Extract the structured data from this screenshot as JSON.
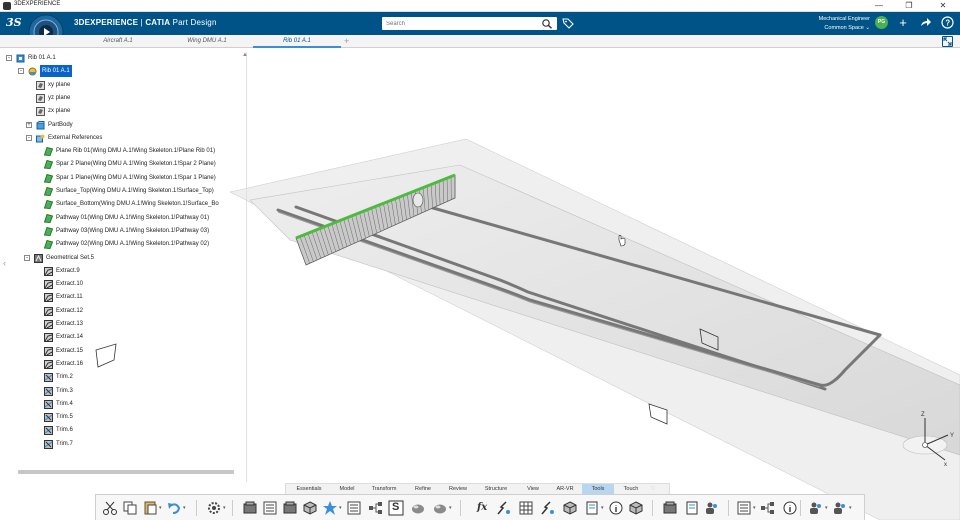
{
  "os": {
    "title": "3DEXPERIENCE",
    "controls": [
      "—",
      "❐",
      "✕"
    ]
  },
  "header": {
    "brand_main": "3DEXPERIENCE",
    "brand_sep": " | ",
    "brand_app_bold": "CATIA",
    "brand_app": " Part Design",
    "search_placeholder": "Search",
    "user_role": "Mechanical Engineer",
    "space": "Common Space",
    "avatar_initials": "PG",
    "accent": "#005386"
  },
  "tabs": [
    {
      "label": "Aircraft A.1",
      "active": false
    },
    {
      "label": "Wing DMU A.1",
      "active": false
    },
    {
      "label": "Rib 01 A.1",
      "active": true
    }
  ],
  "tree": {
    "root": "Rib 01 A.1",
    "part": "Rib 01 A.1",
    "planes": [
      "xy plane",
      "yz plane",
      "zx plane"
    ],
    "partbody": "PartBody",
    "external_references": "External References",
    "references": [
      "Plane Rib 01(Wing DMU A.1!Wing Skeleton.1!Plane Rib 01)",
      "Spar 2 Plane(Wing DMU A.1!Wing Skeleton.1!Spar 2 Plane)",
      "Spar 1 Plane(Wing DMU A.1!Wing Skeleton.1!Spar 1 Plane)",
      "Surface_Top(Wing DMU A.1!Wing Skeleton.1!Surface_Top)",
      "Surface_Bottom(Wing DMU A.1!Wing Skeleton.1!Surface_Bo",
      "Pathway 01(Wing DMU A.1!Wing Skeleton.1!Pathway 01)",
      "Pathway 03(Wing DMU A.1!Wing Skeleton.1!Pathway 03)",
      "Pathway 02(Wing DMU A.1!Wing Skeleton.1!Pathway 02)"
    ],
    "geoset": "Geometrical Set.5",
    "features": [
      "Extract.9",
      "Extract.10",
      "Extract.11",
      "Extract.12",
      "Extract.13",
      "Extract.14",
      "Extract.15",
      "Extract.16",
      "Trim.2",
      "Trim.3",
      "Trim.4",
      "Trim.5",
      "Trim.6",
      "Trim.7"
    ]
  },
  "section_tabs": [
    {
      "label": "Essentials",
      "active": false
    },
    {
      "label": "Model",
      "active": false
    },
    {
      "label": "Transform",
      "active": false
    },
    {
      "label": "Refine",
      "active": false
    },
    {
      "label": "Review",
      "active": false
    },
    {
      "label": "Structure",
      "active": false
    },
    {
      "label": "View",
      "active": false
    },
    {
      "label": "AR-VR",
      "active": false
    },
    {
      "label": "Tools",
      "active": true
    },
    {
      "label": "Touch",
      "active": false
    }
  ],
  "compass_axes": {
    "x": "x",
    "y": "Y",
    "z": "Z"
  },
  "toolbar_glyphs": {
    "s_tool": "S",
    "formula": "fx"
  }
}
